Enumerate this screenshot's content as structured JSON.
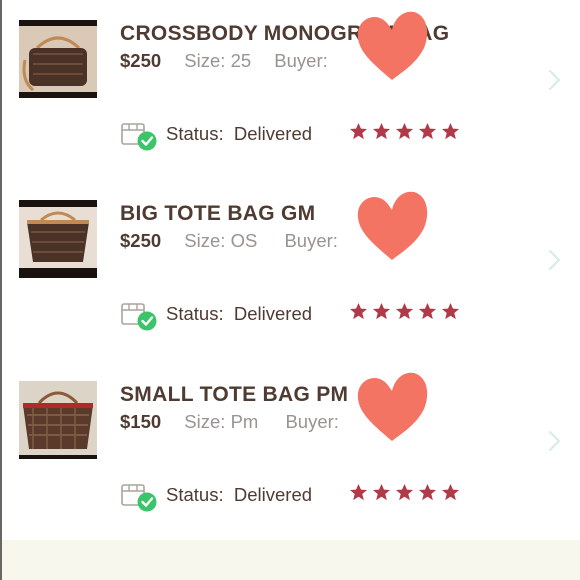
{
  "colors": {
    "star": "#b03a48",
    "heart": "#f47464",
    "title": "#4f3b31",
    "muted": "#9a9390",
    "check": "#3cc46a"
  },
  "orders": [
    {
      "title": "CROSSBODY MONOGRAM BAG",
      "price": "$250",
      "size": "Size: 25",
      "buyer": "Buyer:",
      "status_label": "Status:",
      "status_value": "Delivered",
      "rating": 5
    },
    {
      "title": "BIG TOTE BAG GM",
      "price": "$250",
      "size": "Size: OS",
      "buyer": "Buyer:",
      "status_label": "Status:",
      "status_value": "Delivered",
      "rating": 5
    },
    {
      "title": "SMALL TOTE BAG PM",
      "price": "$150",
      "size": "Size: Pm",
      "buyer": "Buyer:",
      "status_label": "Status:",
      "status_value": "Delivered",
      "rating": 5
    }
  ]
}
